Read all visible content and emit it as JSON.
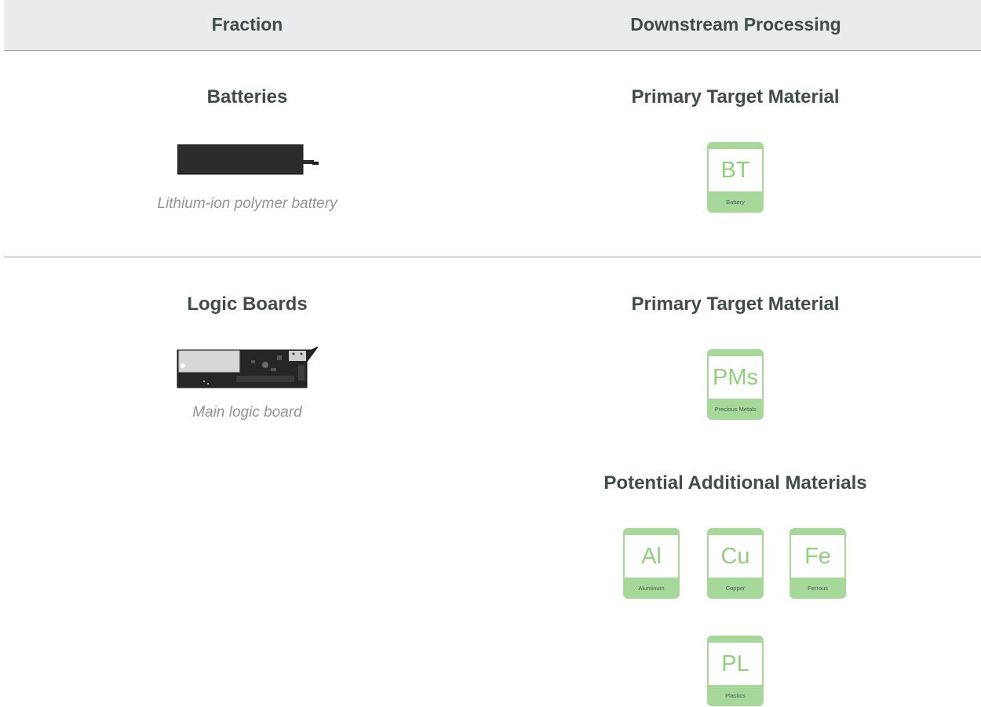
{
  "header": {
    "col1": "Fraction",
    "col2": "Downstream Processing"
  },
  "rows": [
    {
      "fraction_title": "Batteries",
      "image_caption": "Lithium-ion polymer battery",
      "image_icon": "battery-image",
      "primary_heading": "Primary Target Material",
      "primary_tiles": [
        {
          "symbol": "BT",
          "name": "Battery"
        }
      ]
    },
    {
      "fraction_title": "Logic Boards",
      "image_caption": "Main logic board",
      "image_icon": "logic-board-image",
      "primary_heading": "Primary Target Material",
      "primary_tiles": [
        {
          "symbol": "PMs",
          "name": "Precious Metals"
        }
      ],
      "additional_heading": "Potential Additional Materials",
      "additional_tiles": [
        {
          "symbol": "Al",
          "name": "Aluminum"
        },
        {
          "symbol": "Cu",
          "name": "Copper"
        },
        {
          "symbol": "Fe",
          "name": "Ferrous"
        },
        {
          "symbol": "PL",
          "name": "Plastics"
        }
      ]
    }
  ],
  "colors": {
    "tile_green": "#a6d89a",
    "symbol_green": "#8fd07d",
    "heading_text": "#3f4e45",
    "caption_text": "#8e9592",
    "header_bg": "#e9ebec"
  }
}
